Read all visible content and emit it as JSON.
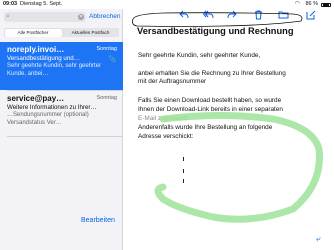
{
  "statusbar": {
    "time": "09:03",
    "date": "Dienstag 5. Sept.",
    "battery": "86 %"
  },
  "search": {
    "value": "",
    "placeholder": ""
  },
  "cancel_label": "Abbrechen",
  "segments": [
    "Alle Postfächer",
    "Aktuelles Postfach"
  ],
  "mails": [
    {
      "sender": "noreply.invoi…",
      "date": "Sonntag",
      "subject": "Versandbestätigung und…",
      "preview": "Sehr geehrte Kundin, sehr geehrter Kunde, anbei…"
    },
    {
      "sender": "service@pay…",
      "date": "Sonntag",
      "subject": "Weitere Informationen zu Ihrer…",
      "preview": "…Sendungsnummer (optional)               Versandstatus Ver…"
    }
  ],
  "edit_label": "Bearbeiten",
  "message": {
    "title": "Versandbestätigung und Rechnung",
    "salutation": "Sehr geehrte Kundin, sehr geehrter Kunde,",
    "line2a": "anbei erhalten Sie die Rechnung zu Ihrer Bestellung",
    "line2b": "mit der Auftragsnummer",
    "line3a": "Falls Sie einen Download bestellt haben, so wurde",
    "line3b": "Ihnen der Download-Link bereits in einer separaten",
    "line3c": "E-Mail zugesandt.",
    "line4a": "Anderenfalls wurde Ihre Bestellung an folgende",
    "line4b": "Adresse verschickt:"
  },
  "colors": {
    "accent": "#0a64e6",
    "selected_row": "#1d74f5",
    "highlighter": "#9ee39a"
  },
  "icons": {
    "search": "magnifier",
    "clear": "x-circle",
    "attach": "paperclip",
    "reply": "reply",
    "reply_all": "reply-all",
    "forward": "forward",
    "trash": "trash",
    "folder": "folder",
    "compose": "compose"
  }
}
